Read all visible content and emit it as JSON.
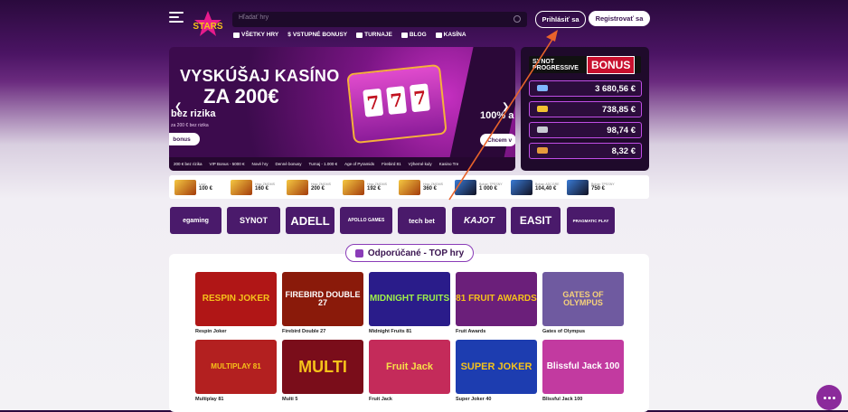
{
  "header": {
    "logo_text": "Tipsport STARS",
    "search_placeholder": "Hľadať hry",
    "login_label": "Prihlásiť sa",
    "register_label": "Registrovať sa"
  },
  "nav": [
    {
      "label": "VŠETKY HRY",
      "icon": "grid-icon"
    },
    {
      "label": "VSTUPNÉ BONUSY",
      "icon": "dollar-icon"
    },
    {
      "label": "TURNAJE",
      "icon": "trophy-icon"
    },
    {
      "label": "BLOG",
      "icon": "blog-icon"
    },
    {
      "label": "KASÍNA",
      "icon": "casino-icon"
    }
  ],
  "banner": {
    "headline1": "VYSKÚŠAJ KASÍNO",
    "headline2": "ZA 200€",
    "sub1": "bez rizika",
    "sub2": "za 200 € bez rizika",
    "btn1": "bonus",
    "right_headline": "100% a",
    "btn2": "Chcem v",
    "ticker": [
      "200 € bez rizika",
      "VIP Bonus - 5000 €",
      "Nové hry",
      "Denné bonusy",
      "Turnaj - 1.000 €",
      "Age of Pyramids",
      "Firebird 81",
      "Výherné kuly",
      "Kasino Tre"
    ],
    "reels": [
      "7",
      "7",
      "7"
    ]
  },
  "bonus": {
    "brand": "SYNOT PROGRESSIVE",
    "label": "BONUS",
    "jackpots": [
      {
        "value": "3 680,56 €",
        "color": "#7fb8ff"
      },
      {
        "value": "738,85 €",
        "color": "#f2c230"
      },
      {
        "value": "98,74 €",
        "color": "#c9ccd4"
      },
      {
        "value": "8,32 €",
        "color": "#e59b3c"
      }
    ]
  },
  "winners": [
    {
      "label": "Lucy",
      "amount": "100 €"
    },
    {
      "label": "Hrac ZMGMS",
      "amount": "160 €"
    },
    {
      "label": "Hrac ZMGMS",
      "amount": "200 €"
    },
    {
      "label": "Hrac ZMGMS",
      "amount": "192 €"
    },
    {
      "label": "Hrac ZMGMS",
      "amount": "360 €"
    },
    {
      "label": "Bohan TPSSNY",
      "amount": "1 000 €"
    },
    {
      "label": "Bohan ADCGRE",
      "amount": "104,40 €"
    },
    {
      "label": "Bohan TPSSNY",
      "amount": "750 €"
    }
  ],
  "providers": [
    "egaming",
    "SYNOT",
    "ADELL",
    "APOLLO GAMES",
    "tech bet",
    "KAJOT",
    "EASIT",
    "PRAGMATIC PLAY"
  ],
  "recommended": {
    "title": "Odporúčané - TOP hry",
    "games": [
      {
        "name": "Respin Joker",
        "art": "RESPIN JOKER",
        "bg": "#b01616"
      },
      {
        "name": "Firebird Double 27",
        "art": "FIREBIRD DOUBLE 27",
        "bg": "#8a1a0a"
      },
      {
        "name": "Midnight Fruits 81",
        "art": "MIDNIGHT FRUITS",
        "bg": "#2a1c8a"
      },
      {
        "name": "Fruit Awards",
        "art": "81 FRUIT AWARDS",
        "bg": "#6b1f7a"
      },
      {
        "name": "Gates of Olympus",
        "art": "GATES OF OLYMPUS",
        "bg": "#6f5aa0"
      },
      {
        "name": "Multiplay 81",
        "art": "MULTIPLAY 81",
        "bg": "#b32020"
      },
      {
        "name": "Multi 5",
        "art": "MULTI",
        "bg": "#7a0d1a"
      },
      {
        "name": "Fruit Jack",
        "art": "Fruit Jack",
        "bg": "#c42b5a"
      },
      {
        "name": "Super Joker 40",
        "art": "SUPER JOKER",
        "bg": "#1d3db0"
      },
      {
        "name": "Blissful Jack 100",
        "art": "Blissful Jack 100",
        "bg": "#c23aa0"
      }
    ]
  }
}
